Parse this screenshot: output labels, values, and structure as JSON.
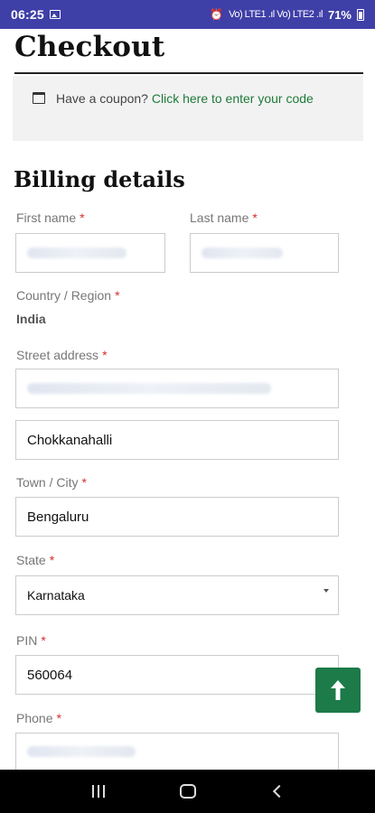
{
  "status_bar": {
    "time": "06:25",
    "network": "Vo) LTE1 .ıl Vo) LTE2 .ıl",
    "battery": "71%"
  },
  "page": {
    "title": "Checkout",
    "coupon_text": "Have a coupon?",
    "coupon_link": "Click here to enter your code",
    "section_title": "Billing details"
  },
  "form": {
    "required_mark": "*",
    "first_name_label": "First name",
    "last_name_label": "Last name",
    "country_label": "Country / Region",
    "country_value": "India",
    "street_label": "Street address",
    "street_line2_value": "Chokkanahalli",
    "city_label": "Town / City",
    "city_value": "Bengaluru",
    "state_label": "State",
    "state_value": "Karnataka",
    "pin_label": "PIN",
    "pin_value": "560064",
    "phone_label": "Phone"
  },
  "icons": {
    "coupon": "coupon-icon",
    "scroll_top": "arrow-up-icon",
    "nav_recent": "recent-apps-icon",
    "nav_home": "home-icon",
    "nav_back": "back-icon"
  },
  "colors": {
    "status_bar": "#3f3fa8",
    "link": "#1f7a3a",
    "required": "#d32f2f",
    "fab": "#1d7a49"
  }
}
